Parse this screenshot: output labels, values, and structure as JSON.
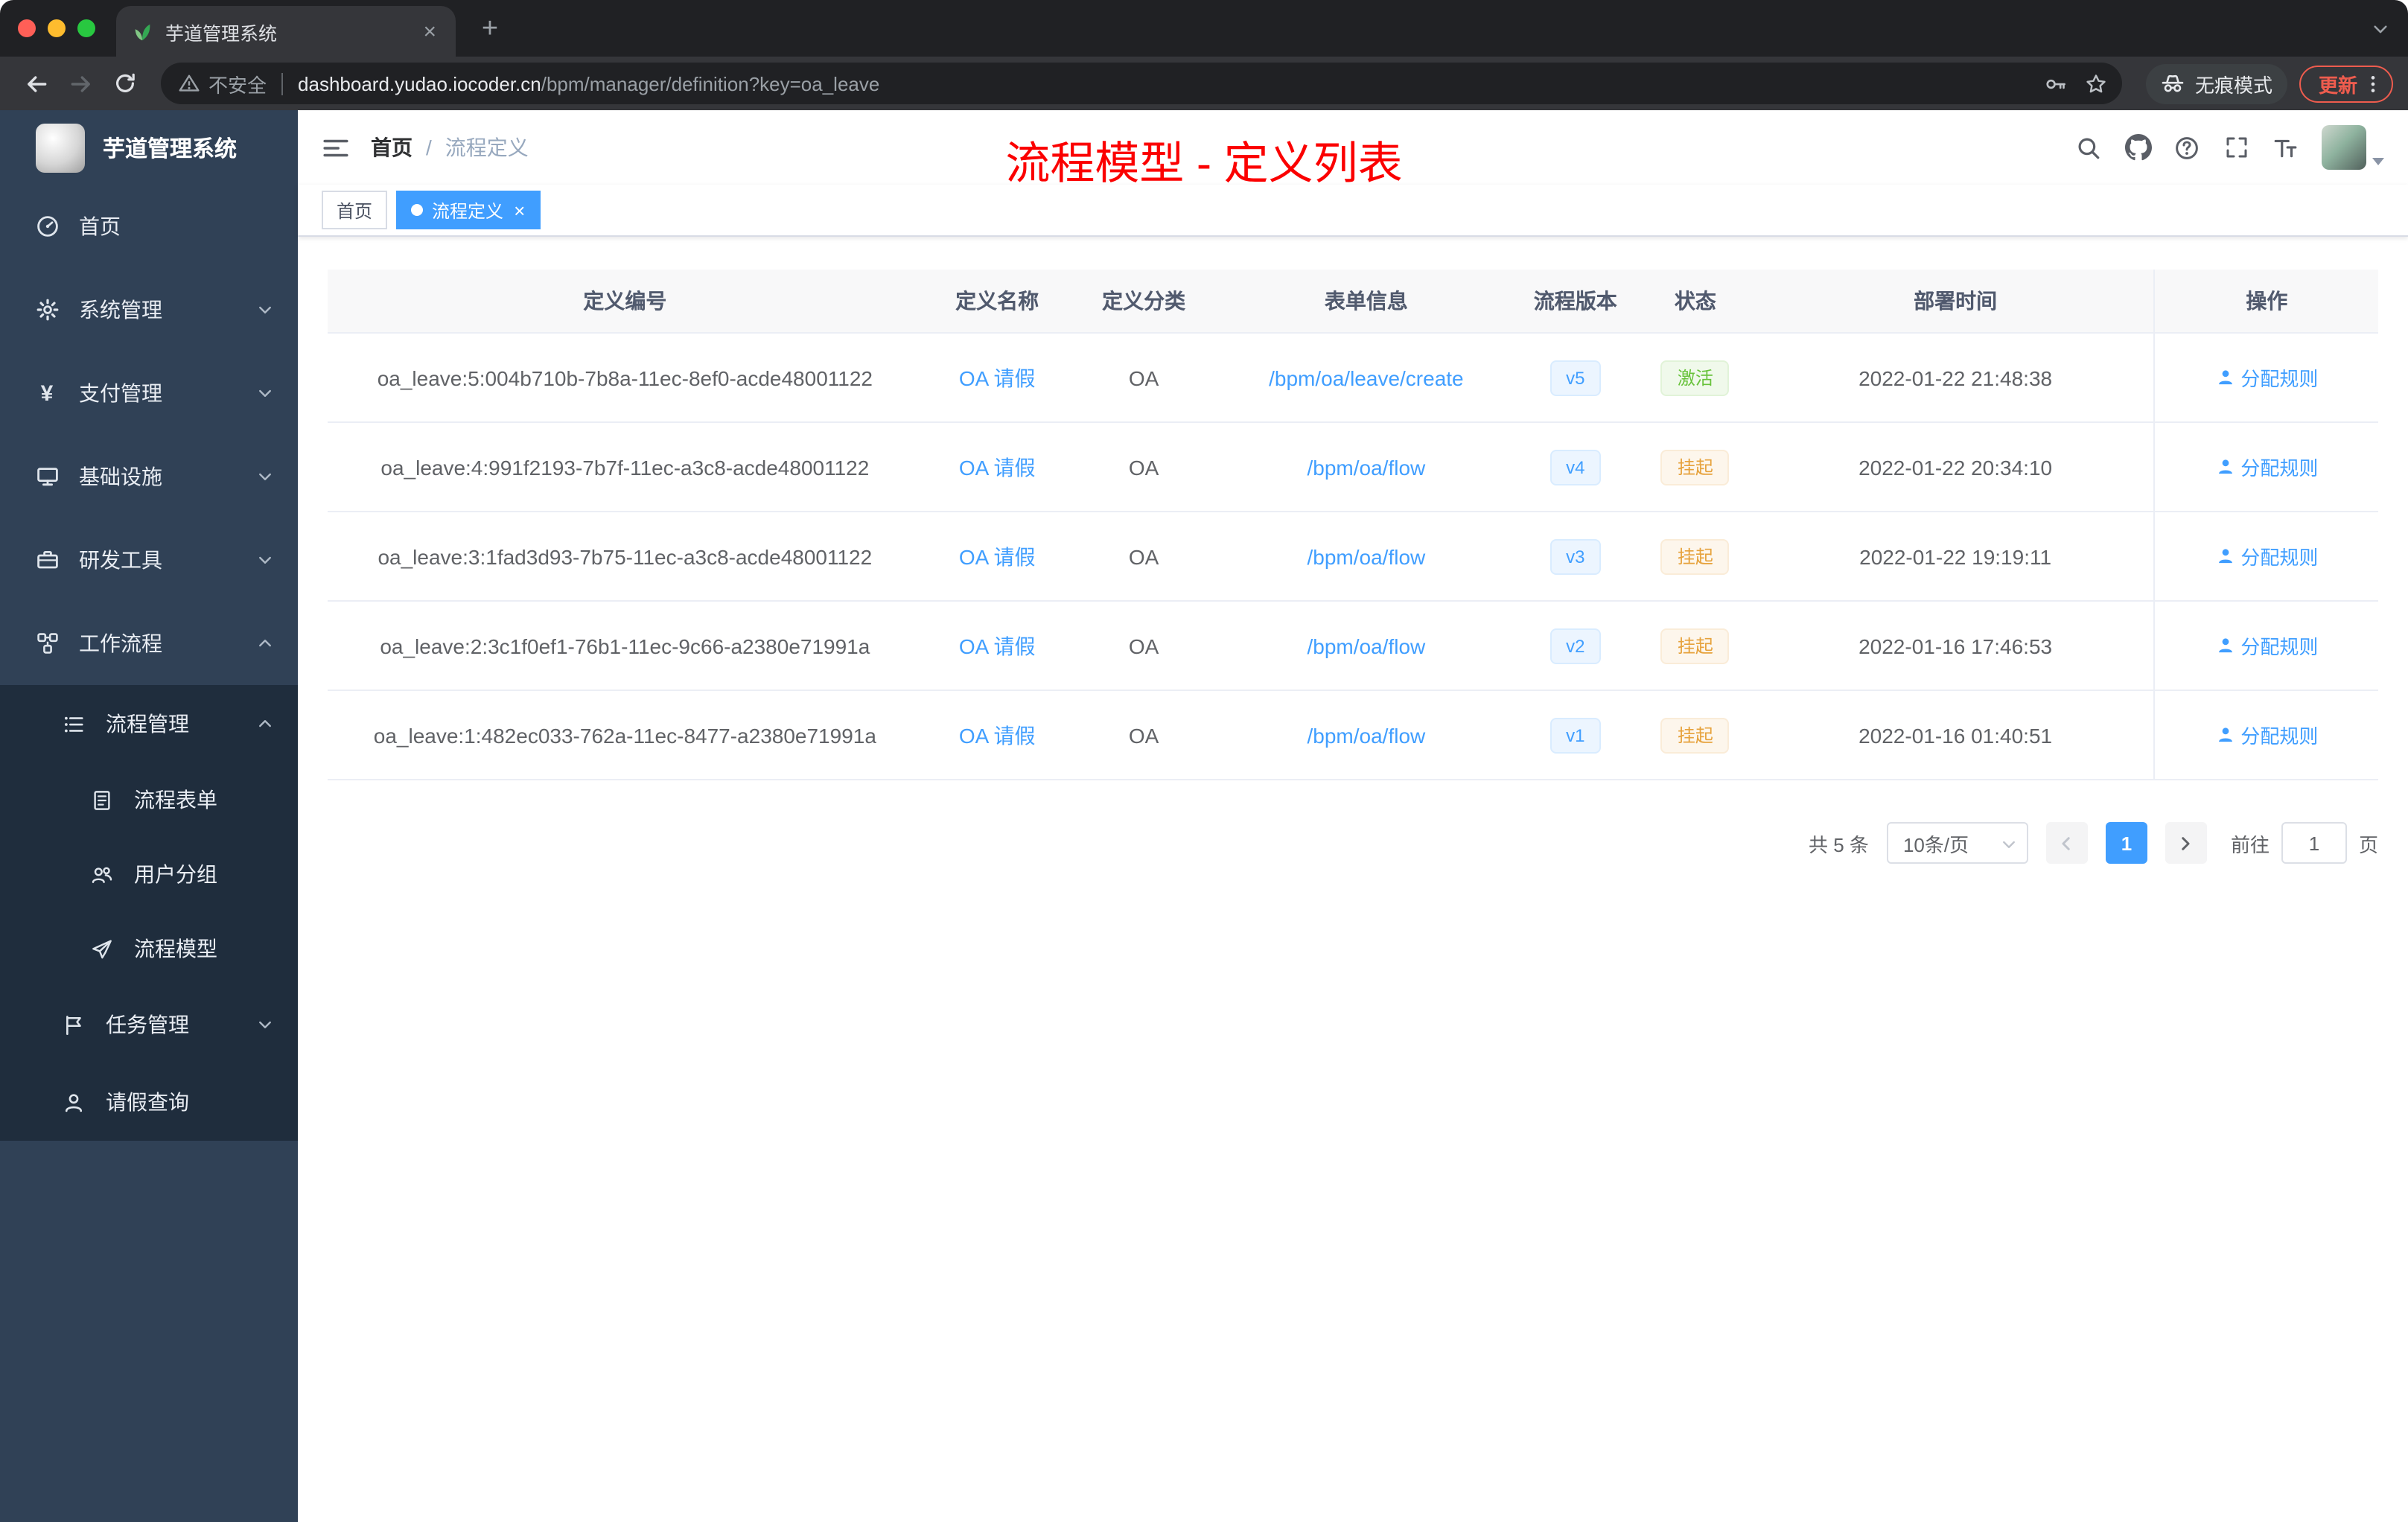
{
  "colors": {
    "accent": "#409eff",
    "success": "#67c23a",
    "warning": "#e6a23c",
    "annotation_red": "#fb0000",
    "sidebar_bg": "#304156",
    "submenu_bg": "#1f2d3d"
  },
  "glyphs": {
    "close": "×",
    "plus": "+",
    "yen": "¥"
  },
  "browser": {
    "tab_title": "芋道管理系统",
    "security_label": "不安全",
    "url_host": "dashboard.yudao.iocoder.cn",
    "url_path": "/bpm/manager/definition?key=oa_leave",
    "incognito_label": "无痕模式",
    "update_label": "更新"
  },
  "sidebar": {
    "logo_title": "芋道管理系统",
    "items": [
      {
        "label": "首页"
      },
      {
        "label": "系统管理"
      },
      {
        "label": "支付管理"
      },
      {
        "label": "基础设施"
      },
      {
        "label": "研发工具"
      },
      {
        "label": "工作流程"
      }
    ],
    "submenu": [
      {
        "label": "流程管理"
      },
      {
        "label": "流程表单"
      },
      {
        "label": "用户分组"
      },
      {
        "label": "流程模型"
      },
      {
        "label": "任务管理"
      },
      {
        "label": "请假查询"
      }
    ]
  },
  "header": {
    "breadcrumb_home": "首页",
    "breadcrumb_sep": "/",
    "breadcrumb_current": "流程定义",
    "annotation": "流程模型 - 定义列表"
  },
  "tags": {
    "home": "首页",
    "current": "流程定义"
  },
  "table": {
    "columns": [
      "定义编号",
      "定义名称",
      "定义分类",
      "表单信息",
      "流程版本",
      "状态",
      "部署时间",
      "操作"
    ],
    "rows": [
      {
        "id": "oa_leave:5:004b710b-7b8a-11ec-8ef0-acde48001122",
        "name": "OA 请假",
        "category": "OA",
        "form": "/bpm/oa/leave/create",
        "version": "v5",
        "status": "激活",
        "time": "2022-01-22 21:48:38",
        "action": "分配规则"
      },
      {
        "id": "oa_leave:4:991f2193-7b7f-11ec-a3c8-acde48001122",
        "name": "OA 请假",
        "category": "OA",
        "form": "/bpm/oa/flow",
        "version": "v4",
        "status": "挂起",
        "time": "2022-01-22 20:34:10",
        "action": "分配规则"
      },
      {
        "id": "oa_leave:3:1fad3d93-7b75-11ec-a3c8-acde48001122",
        "name": "OA 请假",
        "category": "OA",
        "form": "/bpm/oa/flow",
        "version": "v3",
        "status": "挂起",
        "time": "2022-01-22 19:19:11",
        "action": "分配规则"
      },
      {
        "id": "oa_leave:2:3c1f0ef1-76b1-11ec-9c66-a2380e71991a",
        "name": "OA 请假",
        "category": "OA",
        "form": "/bpm/oa/flow",
        "version": "v2",
        "status": "挂起",
        "time": "2022-01-16 17:46:53",
        "action": "分配规则"
      },
      {
        "id": "oa_leave:1:482ec033-762a-11ec-8477-a2380e71991a",
        "name": "OA 请假",
        "category": "OA",
        "form": "/bpm/oa/flow",
        "version": "v1",
        "status": "挂起",
        "time": "2022-01-16 01:40:51",
        "action": "分配规则"
      }
    ]
  },
  "pagination": {
    "total": "共 5 条",
    "page_size": "10条/页",
    "page": "1",
    "goto_label": "前往",
    "goto_value": "1",
    "unit": "页"
  }
}
